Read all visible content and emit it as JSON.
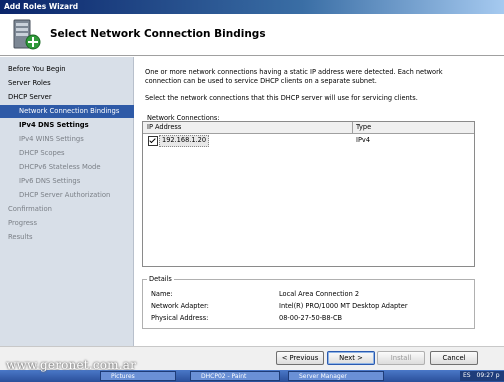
{
  "window": {
    "title": "Add Roles Wizard"
  },
  "header": {
    "title": "Select Network Connection Bindings",
    "icon": "server-add-icon"
  },
  "nav": {
    "items": [
      {
        "label": "Before You Begin",
        "state": "normal"
      },
      {
        "label": "Server Roles",
        "state": "normal"
      },
      {
        "label": "DHCP Server",
        "state": "normal"
      },
      {
        "label": "Network Connection Bindings",
        "state": "selected"
      },
      {
        "label": "IPv4 DNS Settings",
        "state": "bold"
      },
      {
        "label": "IPv4 WINS Settings",
        "state": "dim"
      },
      {
        "label": "DHCP Scopes",
        "state": "dim"
      },
      {
        "label": "DHCPv6 Stateless Mode",
        "state": "dim"
      },
      {
        "label": "IPv6 DNS Settings",
        "state": "dim"
      },
      {
        "label": "DHCP Server Authorization",
        "state": "dim"
      },
      {
        "label": "Confirmation",
        "state": "dim"
      },
      {
        "label": "Progress",
        "state": "dim"
      },
      {
        "label": "Results",
        "state": "dim"
      }
    ]
  },
  "content": {
    "intro": "One or more network connections having a static IP address were detected. Each network connection can be used to service DHCP clients on a separate subnet.",
    "instruction": "Select the network connections that this DHCP server will use for servicing clients.",
    "connections_label": "Network Connections:",
    "columns": [
      "IP Address",
      "Type"
    ],
    "rows": [
      {
        "checked": true,
        "ip": "192.168.1.20",
        "type": "IPv4"
      }
    ]
  },
  "details": {
    "label": "Details",
    "name_label": "Name:",
    "name_value": "Local Area Connection 2",
    "adapter_label": "Network Adapter:",
    "adapter_value": "Intel(R) PRO/1000 MT Desktop Adapter",
    "mac_label": "Physical Address:",
    "mac_value": "08-00-27-50-B8-CB"
  },
  "buttons": {
    "previous": "< Previous",
    "next": "Next >",
    "install": "Install",
    "cancel": "Cancel"
  },
  "taskbar": {
    "items": [
      "Pictures",
      "DHCP02 - Paint",
      "Server Manager"
    ],
    "tray_text": "ES",
    "clock": "09:27 p"
  },
  "watermark": "www.geronet.com.ar",
  "colors": {
    "accent": "#2e5aa7",
    "nav_bg": "#d8dfe8",
    "title_bar": "#0a246a"
  }
}
